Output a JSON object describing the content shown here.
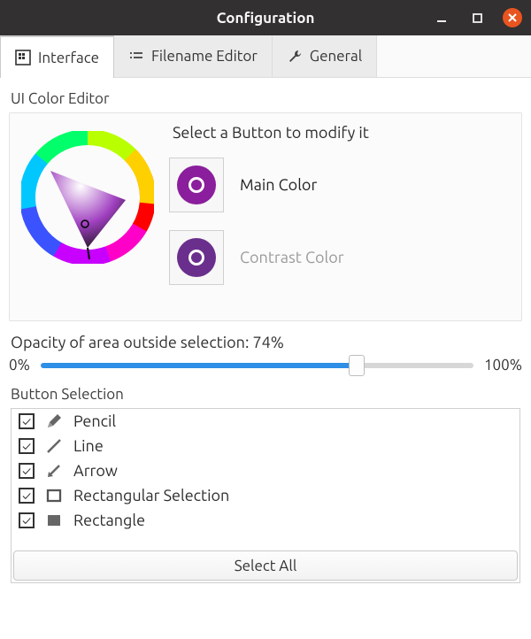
{
  "window": {
    "title": "Configuration"
  },
  "tabs": [
    {
      "label": "Interface",
      "active": true
    },
    {
      "label": "Filename Editor",
      "active": false
    },
    {
      "label": "General",
      "active": false
    }
  ],
  "ui_color_editor": {
    "heading": "UI Color Editor",
    "prompt": "Select a Button to modify it",
    "main": {
      "label": "Main Color",
      "color": "#8a1e9c"
    },
    "contrast": {
      "label": "Contrast Color",
      "color": "#6a2f8c"
    }
  },
  "opacity": {
    "label_prefix": "Opacity of area outside selection: ",
    "value": 74,
    "display": "74%",
    "min_label": "0%",
    "max_label": "100%"
  },
  "button_selection": {
    "heading": "Button Selection",
    "select_all": "Select All",
    "items": [
      {
        "label": "Pencil",
        "checked": true
      },
      {
        "label": "Line",
        "checked": true
      },
      {
        "label": "Arrow",
        "checked": true
      },
      {
        "label": "Rectangular Selection",
        "checked": true
      },
      {
        "label": "Rectangle",
        "checked": true
      }
    ]
  }
}
